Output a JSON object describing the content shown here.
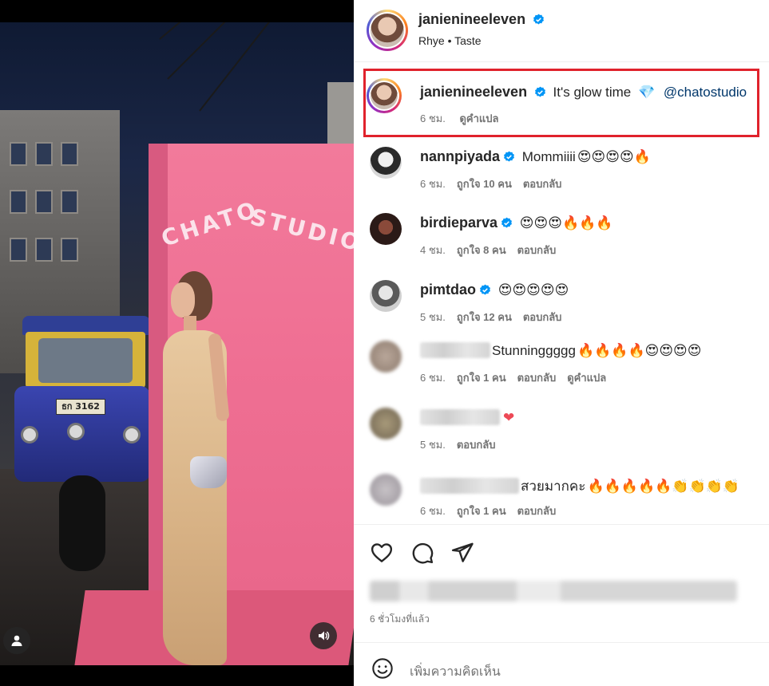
{
  "post": {
    "author": "janienineeleven",
    "audio": "Rhye • Taste",
    "verified_color": "#0095f6"
  },
  "media": {
    "sign_word1": "CHATO",
    "sign_word2": "STUDIO",
    "tuktuk_plate": "ธก 3162",
    "user_icon": "user-tag-icon",
    "sound_icon": "sound-on-icon"
  },
  "caption": {
    "username": "janienineeleven",
    "text": "It's glow time",
    "emoji": "💎",
    "mention": "@chatostudio",
    "time": "6 ชม.",
    "translate": "ดูคำแปล"
  },
  "comments": [
    {
      "username": "nannpiyada",
      "verified": true,
      "text": "Mommiiii",
      "emojis": "😍😍😍😍🔥",
      "time": "6 ชม.",
      "likes": "ถูกใจ 10 คน",
      "reply": "ตอบกลับ",
      "translate": ""
    },
    {
      "username": "birdieparva",
      "verified": true,
      "text": "",
      "emojis": "😍😍😍🔥🔥🔥",
      "time": "4 ชม.",
      "likes": "ถูกใจ 8 คน",
      "reply": "ตอบกลับ",
      "translate": ""
    },
    {
      "username": "pimtdao",
      "verified": true,
      "text": "",
      "emojis": "😍😍😍😍😍",
      "time": "5 ชม.",
      "likes": "ถูกใจ 12 คน",
      "reply": "ตอบกลับ",
      "translate": ""
    },
    {
      "username": "",
      "verified": false,
      "text": "Stunninggggg",
      "emojis": "🔥🔥🔥🔥😍😍😍😍",
      "time": "6 ชม.",
      "likes": "ถูกใจ 1 คน",
      "reply": "ตอบกลับ",
      "translate": "ดูคำแปล"
    },
    {
      "username": "",
      "verified": false,
      "text": "",
      "emojis": "❤",
      "time": "5 ชม.",
      "likes": "",
      "reply": "ตอบกลับ",
      "translate": ""
    },
    {
      "username": "",
      "verified": false,
      "text": "สวยมากคะ",
      "emojis": "🔥🔥🔥🔥🔥👏👏👏👏",
      "time": "6 ชม.",
      "likes": "ถูกใจ 1 คน",
      "reply": "ตอบกลับ",
      "translate": ""
    }
  ],
  "actions": {
    "like_icon": "heart-icon",
    "comment_icon": "comment-icon",
    "share_icon": "paper-plane-icon"
  },
  "time_ago": "6 ชั่วโมงที่แล้ว",
  "add_comment": {
    "placeholder": "เพิ่มความคิดเห็น",
    "emoji_icon": "smiley-icon"
  }
}
